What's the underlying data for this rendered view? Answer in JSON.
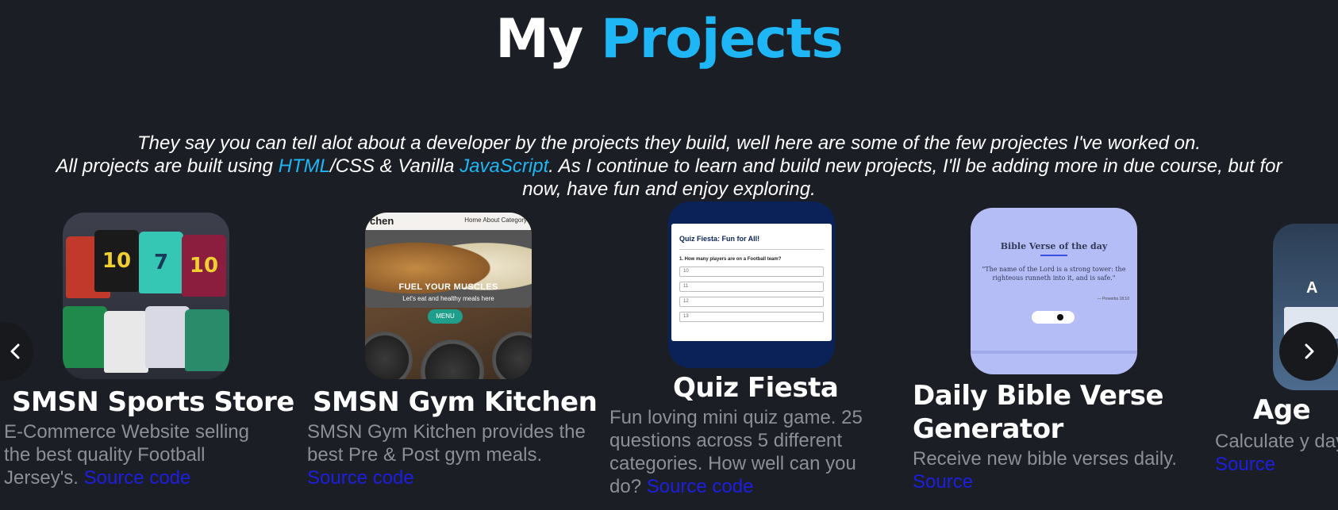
{
  "heading": {
    "part1": "My",
    "part2": "Projects"
  },
  "intro": {
    "line1": "They say you can tell alot about a developer by the projects they build, well here are some of the few projectes I've worked on.",
    "line2_a": "All projects are built using ",
    "line2_html": "HTML",
    "line2_b": "/CSS & Vanilla ",
    "line2_js": "JavaScript",
    "line2_c": ". As I continue to learn and build new projects, I'll be adding more in due course, but for",
    "line3": "now, have fun and enjoy exploring."
  },
  "projects": [
    {
      "title": "SMSN Sports Store",
      "desc": "E-Commerce Website selling the best quality Football Jersey's.",
      "link": "Source code",
      "jersey_numbers": [
        "10",
        "7",
        "10"
      ]
    },
    {
      "title": "SMSN Gym Kitchen",
      "desc": "SMSN Gym Kitchen provides the best Pre & Post gym meals.",
      "link": "Source code",
      "thumb": {
        "brand": "chen",
        "nav_links": "Home   About   Category",
        "hero": "FUEL YOUR MUSCLES",
        "sub": "Let's eat and healthy meals here",
        "button": "MENU"
      }
    },
    {
      "title": "Quiz Fiesta",
      "desc": "Fun loving mini quiz game. 25 questions across 5 different categories. How well can you do?",
      "link": "Source code",
      "thumb": {
        "title": "Quiz Fiesta: Fun for All!",
        "question": "1. How many players are on a Football team?",
        "options": [
          "10",
          "11",
          "12",
          "13"
        ]
      }
    },
    {
      "title": "Daily Bible Verse Generator",
      "desc": "Receive new bible verses daily.",
      "link": "Source",
      "thumb": {
        "title": "Bible Verse of the day",
        "verse": "\"The name of the Lord is a strong tower: the righteous runneth into it, and is safe.\"",
        "ref": "— Proverbs 18:10"
      }
    },
    {
      "title": "Age",
      "desc": "Calculate y day.",
      "link": "Source"
    }
  ],
  "controls": {
    "prev_icon": "chevron-left-icon",
    "next_icon": "chevron-right-icon"
  },
  "colors": {
    "background": "#1b1e24",
    "accent": "#1eb6f5",
    "link": "#1e1ee0",
    "desc": "#8b8f96"
  }
}
